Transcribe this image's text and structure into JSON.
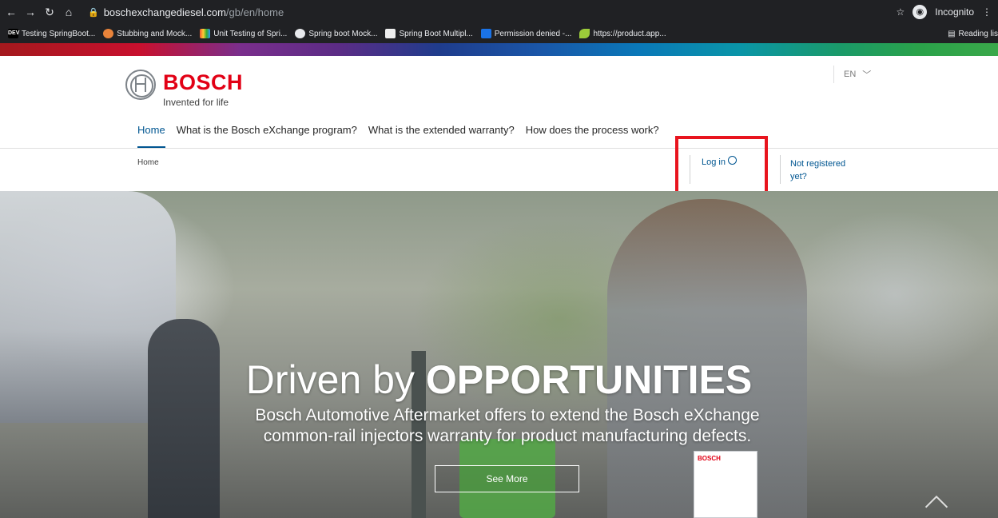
{
  "browser": {
    "url_host": "boschexchangediesel.com",
    "url_path": "/gb/en/home",
    "profile_label": "Incognito",
    "reading_list_label": "Reading lis",
    "bookmarks": [
      {
        "label": "Testing SpringBoot...",
        "icon": "DEV"
      },
      {
        "label": "Stubbing and Mock...",
        "icon": ""
      },
      {
        "label": "Unit Testing of Spri...",
        "icon": ""
      },
      {
        "label": "Spring boot Mock...",
        "icon": ""
      },
      {
        "label": "Spring Boot Multipl...",
        "icon": ""
      },
      {
        "label": "Permission denied -...",
        "icon": ""
      },
      {
        "label": "https://product.app...",
        "icon": ""
      }
    ]
  },
  "header": {
    "brand": "BOSCH",
    "tagline": "Invented for life",
    "language": "EN",
    "nav": [
      "Home",
      "What is the Bosch eXchange program?",
      "What is the extended warranty?",
      "How does the process work?"
    ]
  },
  "subnav": {
    "breadcrumb": "Home",
    "login_label": "Log in",
    "register_line1": "Not registered",
    "register_line2": "yet?"
  },
  "hero": {
    "title_light": "Driven by ",
    "title_bold": "OPPORTUNITIES",
    "subtitle_line1": "Bosch Automotive Aftermarket offers to extend the Bosch eXchange",
    "subtitle_line2": "common-rail injectors warranty for product manufacturing defects.",
    "cta_label": "See More",
    "box_label": "BOSCH"
  },
  "colors": {
    "brand_red": "#e20015",
    "link_blue": "#005691",
    "highlight": "#e8141e"
  }
}
